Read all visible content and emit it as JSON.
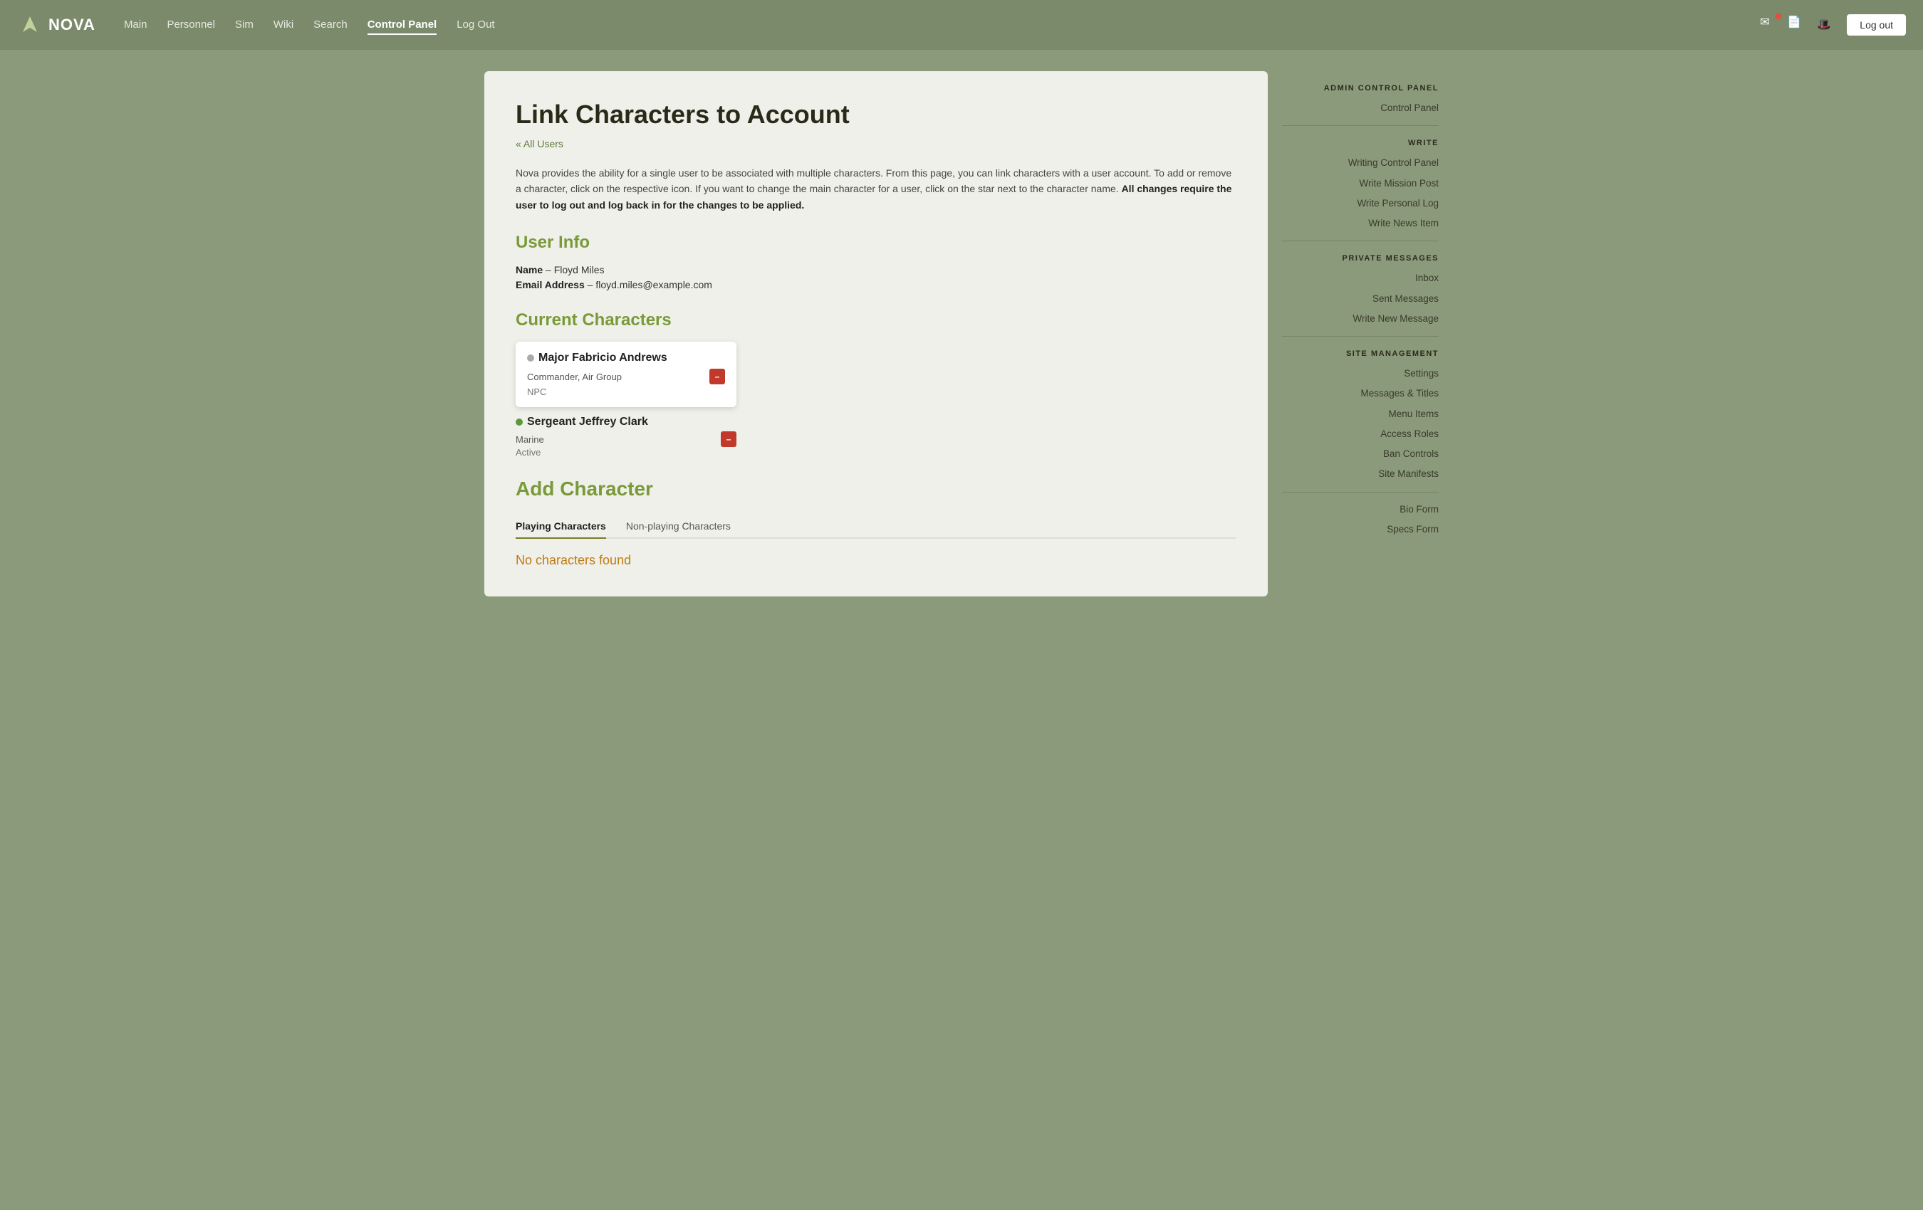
{
  "nav": {
    "logo": "NOVA",
    "links": [
      {
        "label": "Main",
        "active": false
      },
      {
        "label": "Personnel",
        "active": false
      },
      {
        "label": "Sim",
        "active": false
      },
      {
        "label": "Wiki",
        "active": false
      },
      {
        "label": "Search",
        "active": false
      },
      {
        "label": "Control Panel",
        "active": true
      },
      {
        "label": "Log Out",
        "active": false
      }
    ],
    "logout_label": "Log out"
  },
  "page": {
    "title": "Link Characters to Account",
    "breadcrumb": "« All Users",
    "description_normal": "Nova provides the ability for a single user to be associated with multiple characters. From this page, you can link characters with a user account. To add or remove a character, click on the respective icon. If you want to change the main character for a user, click on the star next to the character name. ",
    "description_bold": "All changes require the user to log out and log back in for the changes to be applied."
  },
  "user_info": {
    "section_title": "User Info",
    "name_label": "Name",
    "name_value": "Floyd Miles",
    "email_label": "Email Address",
    "email_value": "floyd.miles@example.com"
  },
  "current_characters": {
    "section_title": "Current Characters",
    "characters": [
      {
        "name": "Major Fabricio Andrews",
        "position": "Commander, Air Group",
        "type": "NPC",
        "status": "inactive"
      },
      {
        "name": "Sergeant Jeffrey Clark",
        "position": "Marine",
        "type": "Active",
        "status": "active"
      }
    ]
  },
  "add_character": {
    "section_title": "Add Character",
    "tabs": [
      {
        "label": "Playing Characters",
        "active": true
      },
      {
        "label": "Non-playing Characters",
        "active": false
      }
    ],
    "no_chars_message": "No characters found"
  },
  "sidebar": {
    "admin_title": "ADMIN CONTROL PANEL",
    "sections": [
      {
        "items": [
          {
            "label": "Control Panel"
          }
        ]
      },
      {
        "title": "WRITE",
        "items": [
          {
            "label": "Writing Control Panel"
          },
          {
            "label": "Write Mission Post"
          },
          {
            "label": "Write Personal Log"
          },
          {
            "label": "Write News Item"
          }
        ]
      },
      {
        "title": "PRIVATE MESSAGES",
        "items": [
          {
            "label": "Inbox"
          },
          {
            "label": "Sent Messages"
          },
          {
            "label": "Write New Message"
          }
        ]
      },
      {
        "title": "SITE MANAGEMENT",
        "items": [
          {
            "label": "Settings"
          },
          {
            "label": "Messages & Titles"
          },
          {
            "label": "Menu Items"
          },
          {
            "label": "Access Roles"
          },
          {
            "label": "Ban Controls"
          },
          {
            "label": "Site Manifests"
          }
        ]
      },
      {
        "items": [
          {
            "label": "Bio Form"
          },
          {
            "label": "Specs Form"
          }
        ]
      }
    ]
  }
}
